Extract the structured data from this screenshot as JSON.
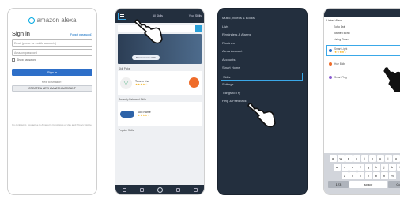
{
  "panel1": {
    "logo": "amazon alexa",
    "title": "Sign in",
    "forgot_link": "Forgot password?",
    "email_placeholder": "Email (phone for mobile accounts)",
    "password_placeholder": "Amazon password",
    "show_password": "Show password",
    "signin_button": "Sign in",
    "new_label": "New to Amazon?",
    "create_button": "CREATE A NEW AMAZON ACCOUNT",
    "legal": "By continuing, you agree to Amazon's Conditions of Use and Privacy Notice."
  },
  "panel2": {
    "tab": "All Skills",
    "header_right": "Your Skills",
    "search_placeholder": "Search",
    "hero_button": "Discover new skills",
    "section1": "Skill Picks",
    "skill1_name": "TuneIn Live",
    "skill1_stars": "★★★★☆",
    "section2": "Recently Released Skills",
    "skill2_name": "Skill Name",
    "skill2_stars": "★★★★☆",
    "section3": "Popular Skills"
  },
  "panel3": {
    "menu": [
      "Music, Videos & Books",
      "Lists",
      "Reminders & Alarms",
      "Routines",
      "Alexa Account",
      "Accounts",
      "Smart Home",
      "Skills",
      "Settings",
      "Things to Try",
      "Help & Feedback"
    ],
    "highlighted": "Skills"
  },
  "panel4": {
    "title": "Devices",
    "list_head": "Linked Alexa",
    "rows": [
      "Echo Dot",
      "Kitchen Echo",
      "Living Room"
    ],
    "device_name": "Smart Light",
    "device_stars": "★★★★☆",
    "device2": "Hue Bulb",
    "device3": "Smart Plug",
    "kbd_label": "Connected devices",
    "keys_row1": [
      "q",
      "w",
      "e",
      "r",
      "t",
      "y",
      "u",
      "i",
      "o",
      "p"
    ],
    "keys_row2": [
      "a",
      "s",
      "d",
      "f",
      "g",
      "h",
      "j",
      "k",
      "l"
    ],
    "keys_row3": [
      "z",
      "x",
      "c",
      "v",
      "b",
      "n",
      "m"
    ],
    "space_label": "space",
    "return_label": "Go",
    "num_label": "123"
  },
  "colors": {
    "accent": "#3aa8e8",
    "dark_nav": "#232f3e",
    "button_blue": "#2e6fc8",
    "star": "#f2a800"
  }
}
